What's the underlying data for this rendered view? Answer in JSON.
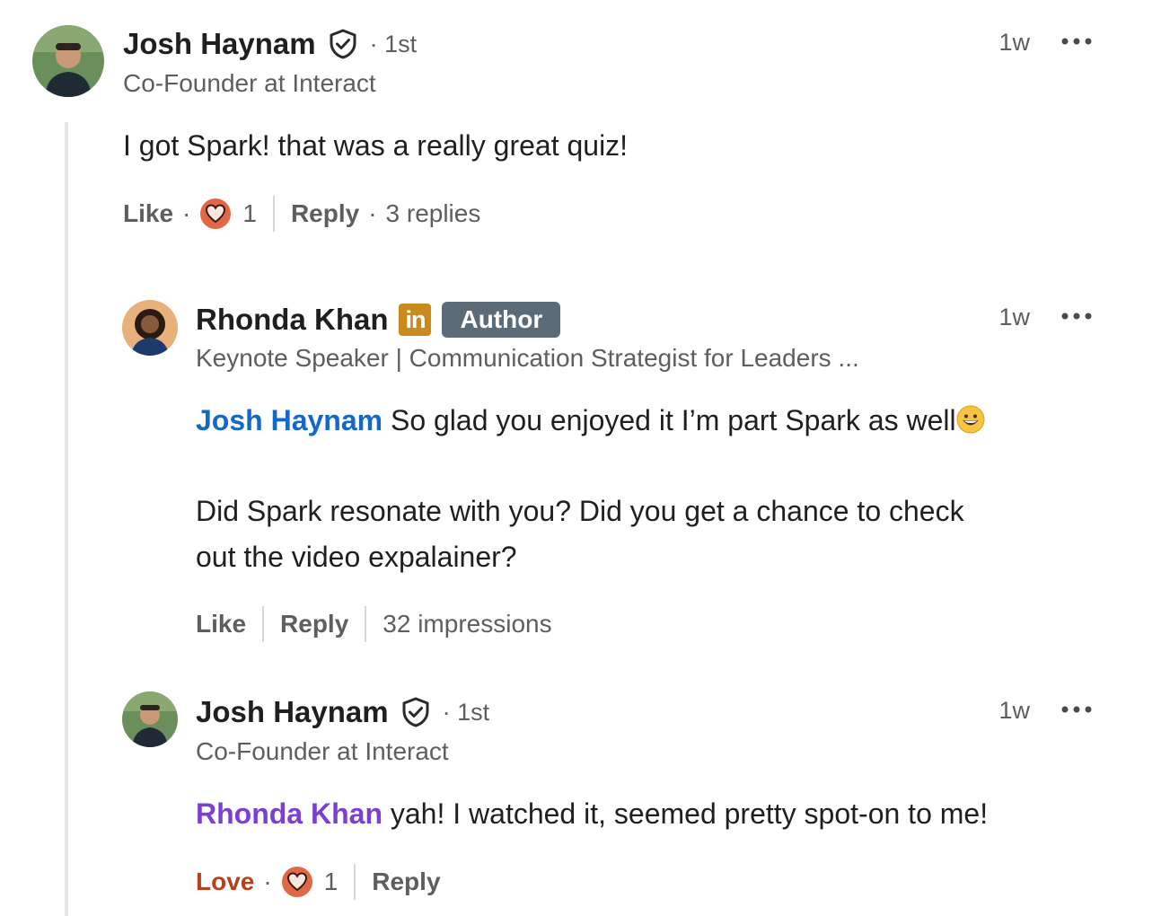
{
  "thread": {
    "main_comment": {
      "author": "Josh Haynam",
      "degree": "· 1st",
      "headline": "Co-Founder at Interact",
      "time": "1w",
      "text": "I got Spark! that was a really great quiz!",
      "actions": {
        "like_label": "Like",
        "reaction_count": "1",
        "reply_label": "Reply",
        "replies_text": "3 replies"
      }
    },
    "reply_1": {
      "author": "Rhonda Khan",
      "linkedin_badge": "in",
      "author_badge": "Author",
      "headline": "Keynote Speaker | Communication Strategist for Leaders ...",
      "time": "1w",
      "mention": "Josh Haynam",
      "line1": " So glad you enjoyed it I’m part Spark as well",
      "line2": "Did Spark resonate with you? Did you get a chance to check",
      "line3": "out the video expalainer?",
      "actions": {
        "like_label": "Like",
        "reply_label": "Reply",
        "impressions": "32 impressions"
      }
    },
    "reply_2": {
      "author": "Josh Haynam",
      "degree": "· 1st",
      "headline": "Co-Founder at Interact",
      "time": "1w",
      "mention": "Rhonda Khan",
      "text": " yah! I watched it, seemed pretty spot-on to me!",
      "actions": {
        "love_label": "Love",
        "reaction_count": "1",
        "reply_label": "Reply"
      }
    }
  },
  "icons": {
    "verified": "shield-check-icon",
    "more": "more-horizontal-icon",
    "heart": "heart-reaction-icon",
    "emoji": "grinning-face-emoji",
    "linkedin": "linkedin-icon"
  },
  "colors": {
    "mention_blue": "#1469c8",
    "mention_purple": "#7b3fd4",
    "love_red": "#b8401a",
    "author_badge": "#5b6b78",
    "linkedin_gold": "#c98a1e"
  }
}
